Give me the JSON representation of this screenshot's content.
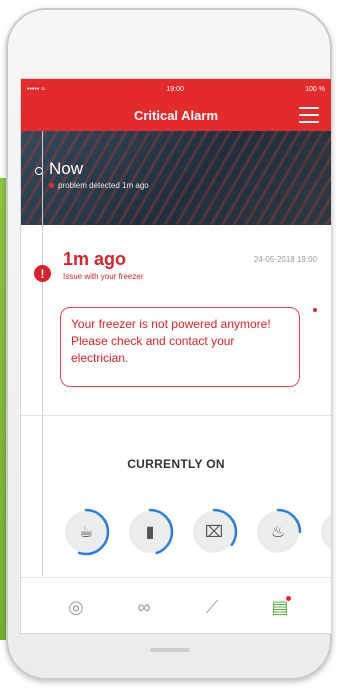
{
  "status_bar": {
    "signal": "••••• ≈",
    "time": "19:00",
    "battery": "100 %"
  },
  "nav": {
    "title": "Critical Alarm"
  },
  "hero": {
    "title": "Now",
    "subtitle": "problem detected 1m ago"
  },
  "alarm": {
    "time_ago": "1m ago",
    "issue": "Issue with your freezer",
    "timestamp": "24-05-2018 19:00",
    "message": "Your freezer is not powered anymore! Please check and contact your electrician."
  },
  "section": {
    "currently_on": "CURRENTLY ON"
  },
  "appliances": [
    {
      "icon": "kettle-icon",
      "glyph": "☕",
      "progress": 0.55
    },
    {
      "icon": "appliance-icon",
      "glyph": "▮",
      "progress": 0.45
    },
    {
      "icon": "washer-icon",
      "glyph": "⌧",
      "progress": 0.35
    },
    {
      "icon": "heater-icon",
      "glyph": "♨",
      "progress": 0.25
    },
    {
      "icon": "device-icon",
      "glyph": "▯",
      "progress": 0.0
    }
  ],
  "tabs": [
    {
      "icon": "home-icon",
      "glyph": "◎",
      "active": false
    },
    {
      "icon": "devices-icon",
      "glyph": "∞",
      "active": false
    },
    {
      "icon": "chart-icon",
      "glyph": "⟋",
      "active": false
    },
    {
      "icon": "notifications-icon",
      "glyph": "▤",
      "active": true
    }
  ],
  "colors": {
    "accent_red": "#e42a2a",
    "active_green": "#5bb04b",
    "ring_blue": "#2f7fe0"
  }
}
